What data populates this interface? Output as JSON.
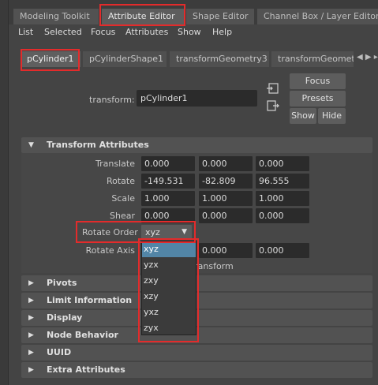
{
  "top_tabs": [
    {
      "label": "Modeling Toolkit"
    },
    {
      "label": "Attribute Editor"
    },
    {
      "label": "Shape Editor"
    },
    {
      "label": "Channel Box / Layer Editor"
    }
  ],
  "menu": [
    "List",
    "Selected",
    "Focus",
    "Attributes",
    "Show",
    "Help"
  ],
  "node_tabs": [
    {
      "label": "pCylinder1"
    },
    {
      "label": "pCylinderShape1"
    },
    {
      "label": "transformGeometry3"
    },
    {
      "label": "transformGeometr"
    }
  ],
  "transform": {
    "label": "transform:",
    "value": "pCylinder1"
  },
  "buttons": {
    "focus": "Focus",
    "presets": "Presets",
    "show": "Show",
    "hide": "Hide"
  },
  "sections": {
    "transform_attributes": "Transform Attributes",
    "pivots": "Pivots",
    "limit_information": "Limit Information",
    "display": "Display",
    "node_behavior": "Node Behavior",
    "uuid": "UUID",
    "extra_attributes": "Extra Attributes"
  },
  "attributes": {
    "translate": {
      "label": "Translate",
      "x": "0.000",
      "y": "0.000",
      "z": "0.000"
    },
    "rotate": {
      "label": "Rotate",
      "x": "-149.531",
      "y": "-82.809",
      "z": "96.555"
    },
    "scale": {
      "label": "Scale",
      "x": "1.000",
      "y": "1.000",
      "z": "1.000"
    },
    "shear": {
      "label": "Shear",
      "x": "0.000",
      "y": "0.000",
      "z": "0.000"
    },
    "rotate_order": {
      "label": "Rotate Order",
      "value": "xyz"
    },
    "rotate_axis": {
      "label": "Rotate Axis",
      "y": "0.000",
      "z": "0.000"
    },
    "inherits_partial": "Transform"
  },
  "rotate_order_options": [
    "xyz",
    "yzx",
    "zxy",
    "xzy",
    "yxz",
    "zyx"
  ],
  "colors": {
    "highlight": "#e32b2b",
    "selected_option": "#5285a6",
    "background": "#444444"
  }
}
